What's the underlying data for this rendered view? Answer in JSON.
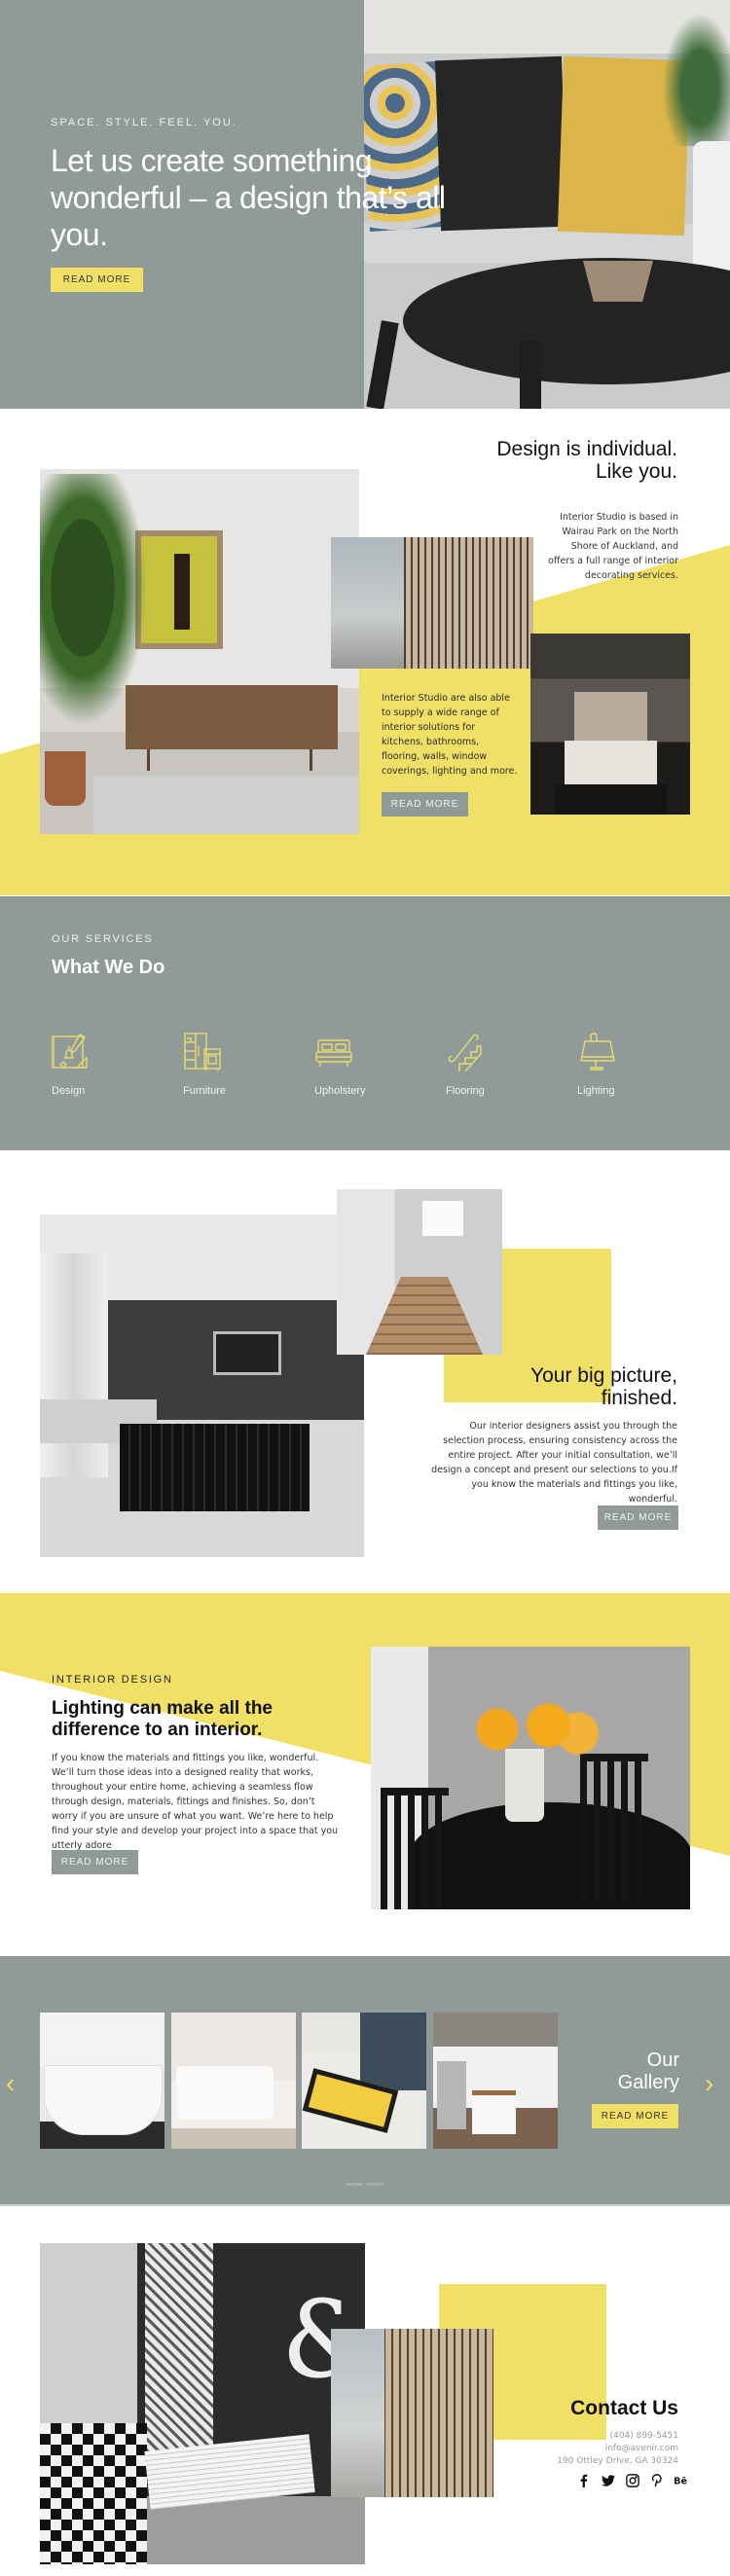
{
  "colors": {
    "accent_yellow": "#f0e065",
    "slate_gray": "#8f9a99",
    "text_dark": "#111111"
  },
  "hero": {
    "tagline": "SPACE. STYLE. FEEL. YOU.",
    "title": "Let us create something wonderful – a design that’s all you.",
    "button_label": "READ MORE"
  },
  "individual": {
    "heading_line1": "Design is individual.",
    "heading_line2": "Like you.",
    "text_right": "Interior Studio is based in Wairau Park on the North Shore of Auckland, and offers a full range of interior decorating services.",
    "text_left": "Interior Studio are also able to supply a wide range of interior solutions for kitchens, bathrooms, flooring, walls, window coverings, lighting and more.",
    "button_label": "READ MORE"
  },
  "services": {
    "label": "OUR SERVICES",
    "title": "What We Do",
    "items": [
      {
        "label": "Design",
        "icon": "blueprint-icon"
      },
      {
        "label": "Furniture",
        "icon": "furniture-icon"
      },
      {
        "label": "Upholstery",
        "icon": "bed-icon"
      },
      {
        "label": "Flooring",
        "icon": "stairs-icon"
      },
      {
        "label": "Lighting",
        "icon": "lamp-icon"
      }
    ]
  },
  "big_picture": {
    "heading_line1": "Your big picture,",
    "heading_line2": "finished.",
    "text": "Our interior designers assist you through the selection process, ensuring consistency across the entire project. After your initial consultation, we’ll design a concept and present our selections to you.If you know the materials and fittings you like, wonderful.",
    "button_label": "READ MORE"
  },
  "interior_design": {
    "label": "INTERIOR DESIGN",
    "heading": "Lighting can make all the difference to an interior.",
    "text": "If you know the materials and fittings you like, wonderful. We’ll turn those ideas into a designed reality that works, throughout your entire home, achieving a seamless flow through design, materials, fittings and finishes. So, don’t worry if you are unsure of what you want. We’re here to help find your style and develop your project into a space that you utterly adore",
    "button_label": "READ MORE"
  },
  "gallery": {
    "title_line1": "Our",
    "title_line2": "Gallery",
    "button_label": "READ MORE",
    "prev_arrow": "‹",
    "next_arrow": "›",
    "image_count": 4,
    "page_count": 2
  },
  "contact": {
    "title": "Contact Us",
    "phone": "(404) 899-5451",
    "email": "info@avenir.com",
    "address": "190 Ottley Drive, GA 30324",
    "socials": [
      {
        "name": "facebook-icon",
        "glyph": "f"
      },
      {
        "name": "twitter-icon",
        "glyph": "t"
      },
      {
        "name": "instagram-icon",
        "glyph": "◎"
      },
      {
        "name": "pinterest-icon",
        "glyph": "p"
      },
      {
        "name": "behance-icon",
        "glyph": "Bē"
      }
    ]
  }
}
